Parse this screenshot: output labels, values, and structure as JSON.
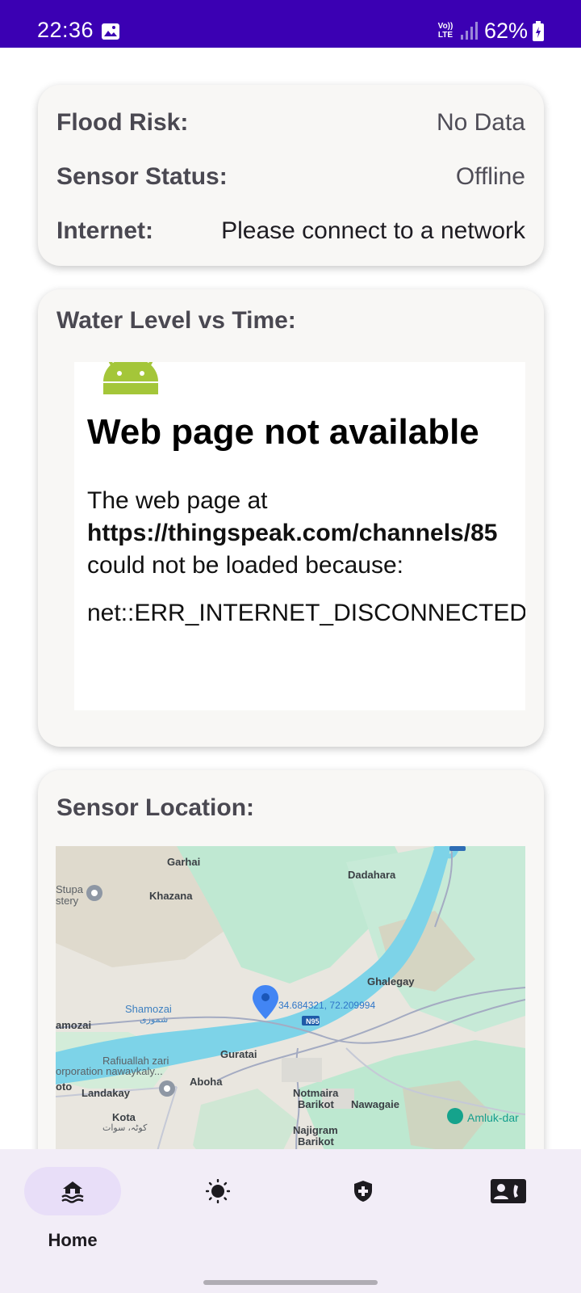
{
  "status_bar": {
    "time": "22:36",
    "network_label": "Vo)) LTE",
    "battery": "62%",
    "background_color": "#3b00b3"
  },
  "status_card": {
    "rows": [
      {
        "label": "Flood Risk:",
        "value": "No Data"
      },
      {
        "label": "Sensor Status:",
        "value": "Offline"
      },
      {
        "label": "Internet:",
        "value": "Please connect to a network"
      }
    ]
  },
  "chart_card": {
    "title": "Water Level vs Time:",
    "webview": {
      "error_title": "Web page not available",
      "line1": "The web page at",
      "url": "https://thingspeak.com/channels/85",
      "line3": "could not be loaded because:",
      "error_code": "net::ERR_INTERNET_DISCONNECTED"
    }
  },
  "map_card": {
    "title": "Sensor Location:",
    "marker_coords": "34.684321, 72.209994",
    "places": {
      "garhai": "Garhai",
      "dadahara": "Dadahara",
      "stupa": "Stupa",
      "stery": "stery",
      "khazana": "Khazana",
      "ghalegay": "Ghalegay",
      "shamozai": "Shamozai",
      "shamozai_urdu": "شموزی",
      "amozai": "amozai",
      "road": "N95",
      "guratai": "Guratai",
      "rafiuallah": "Rafiuallah zari",
      "corporation": "orporation nawaykaly...",
      "oto": "oto",
      "aboha": "Aboha",
      "landakay": "Landakay",
      "notmaira": "Notmaira",
      "barikot1": "Barikot",
      "nawagaie": "Nawagaie",
      "amluk": "Amluk-dar",
      "kota": "Kota",
      "kota_urdu": "کوٹہ، سوات",
      "najigram": "Najigram",
      "barikot2": "Barikot"
    }
  },
  "bottom_nav": {
    "items": [
      {
        "name": "home",
        "label": "Home",
        "icon": "flood-house-icon",
        "active": true
      },
      {
        "name": "weather",
        "label": "",
        "icon": "sun-icon",
        "active": false
      },
      {
        "name": "safety",
        "label": "",
        "icon": "shield-plus-icon",
        "active": false
      },
      {
        "name": "contacts",
        "label": "",
        "icon": "contact-card-icon",
        "active": false
      }
    ],
    "active_color": "#e8def8"
  }
}
